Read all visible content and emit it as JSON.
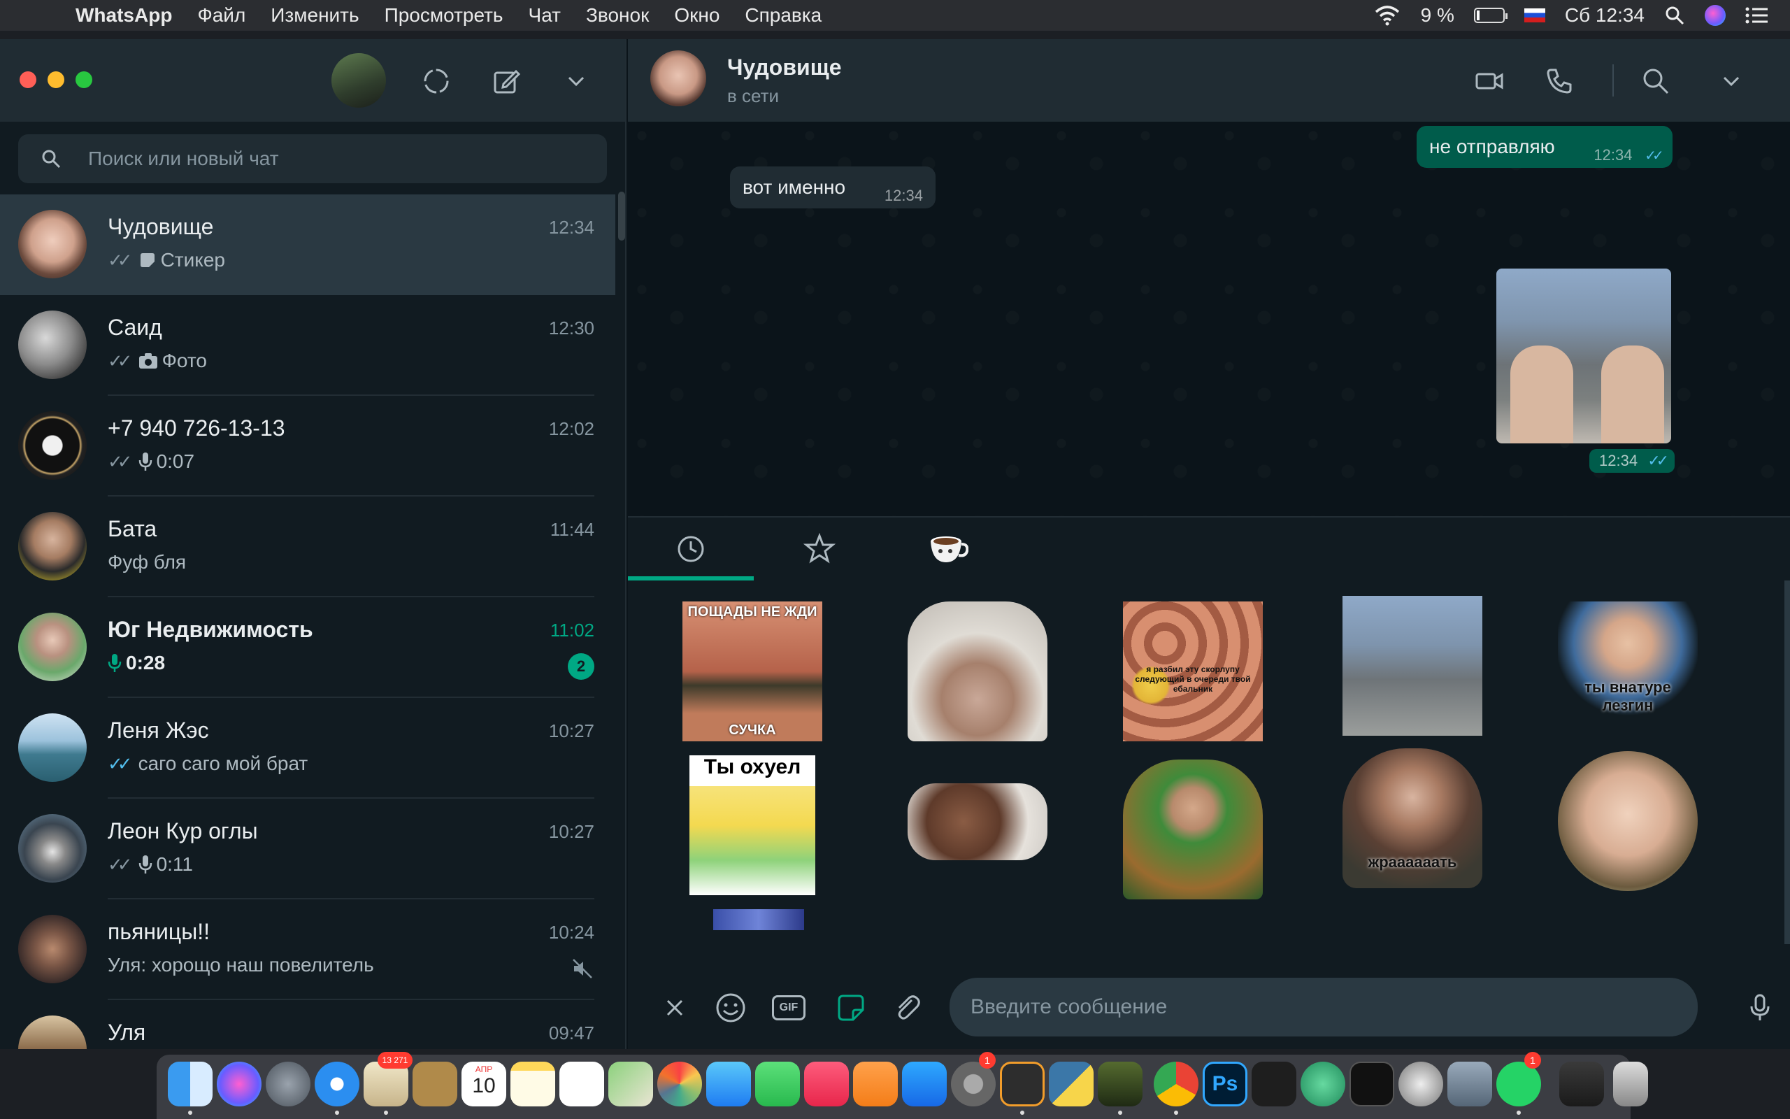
{
  "menubar": {
    "app_name": "WhatsApp",
    "items": [
      "Файл",
      "Изменить",
      "Просмотреть",
      "Чат",
      "Звонок",
      "Окно",
      "Справка"
    ],
    "battery": "9 %",
    "clock": "Сб 12:34"
  },
  "sidebar": {
    "search_placeholder": "Поиск или новый чат",
    "chats": [
      {
        "name": "Чудовище",
        "time": "12:34",
        "preview": "Стикер",
        "preview_icon": "sticker-icon",
        "ticks": "grey"
      },
      {
        "name": "Саид",
        "time": "12:30",
        "preview": "Фото",
        "preview_icon": "camera-icon",
        "ticks": "grey"
      },
      {
        "name": "+7 940 726-13-13",
        "time": "12:02",
        "preview": "0:07",
        "preview_icon": "mic-icon",
        "ticks": "grey"
      },
      {
        "name": "Бата",
        "time": "11:44",
        "preview": "Фуф бля"
      },
      {
        "name": "Юг Недвижимость",
        "time": "11:02",
        "preview": "0:28",
        "preview_icon": "mic-icon",
        "unread": "2"
      },
      {
        "name": "Леня Жэс",
        "time": "10:27",
        "preview": "саго саго мой брат",
        "ticks": "blue"
      },
      {
        "name": "Леон Кур оглы",
        "time": "10:27",
        "preview": "0:11",
        "preview_icon": "mic-icon",
        "ticks": "grey"
      },
      {
        "name": "пьяницы!!",
        "time": "10:24",
        "preview": "Уля: хорощо наш повелитель",
        "muted": true
      },
      {
        "name": "Уля",
        "time": "09:47"
      }
    ]
  },
  "conversation": {
    "contact_name": "Чудовище",
    "status": "в сети",
    "messages": [
      {
        "direction": "out",
        "text": "не отправляю",
        "time": "12:34"
      },
      {
        "direction": "in",
        "text": "вот именно",
        "time": "12:34"
      },
      {
        "direction": "out",
        "type": "sticker",
        "time": "12:34"
      }
    ]
  },
  "sticker_panel": {
    "tabs": [
      "recent-icon",
      "star-icon",
      "coffee-cup-icon"
    ],
    "stickers": [
      {
        "caption_top": "ПОЩАДЫ НЕ ЖДИ",
        "caption_bottom": "СУЧКА"
      },
      {},
      {
        "caption_mid": "я разбил эту скорлупу следующий в очереди твой ебальник"
      },
      {},
      {
        "caption_mid": "ты внатуре лезгин"
      },
      {
        "caption_top": "Ты охуел"
      },
      {},
      {},
      {
        "caption_mid": "жраааааать"
      },
      {}
    ]
  },
  "composer": {
    "placeholder": "Введите сообщение",
    "gif_label": "GIF"
  },
  "dock": {
    "mail_badge": "13 271",
    "calendar_month": "АПР",
    "calendar_day": "10",
    "badge_sysprefs": "1",
    "badge_whatsapp": "1",
    "ps_label": "Ps"
  }
}
